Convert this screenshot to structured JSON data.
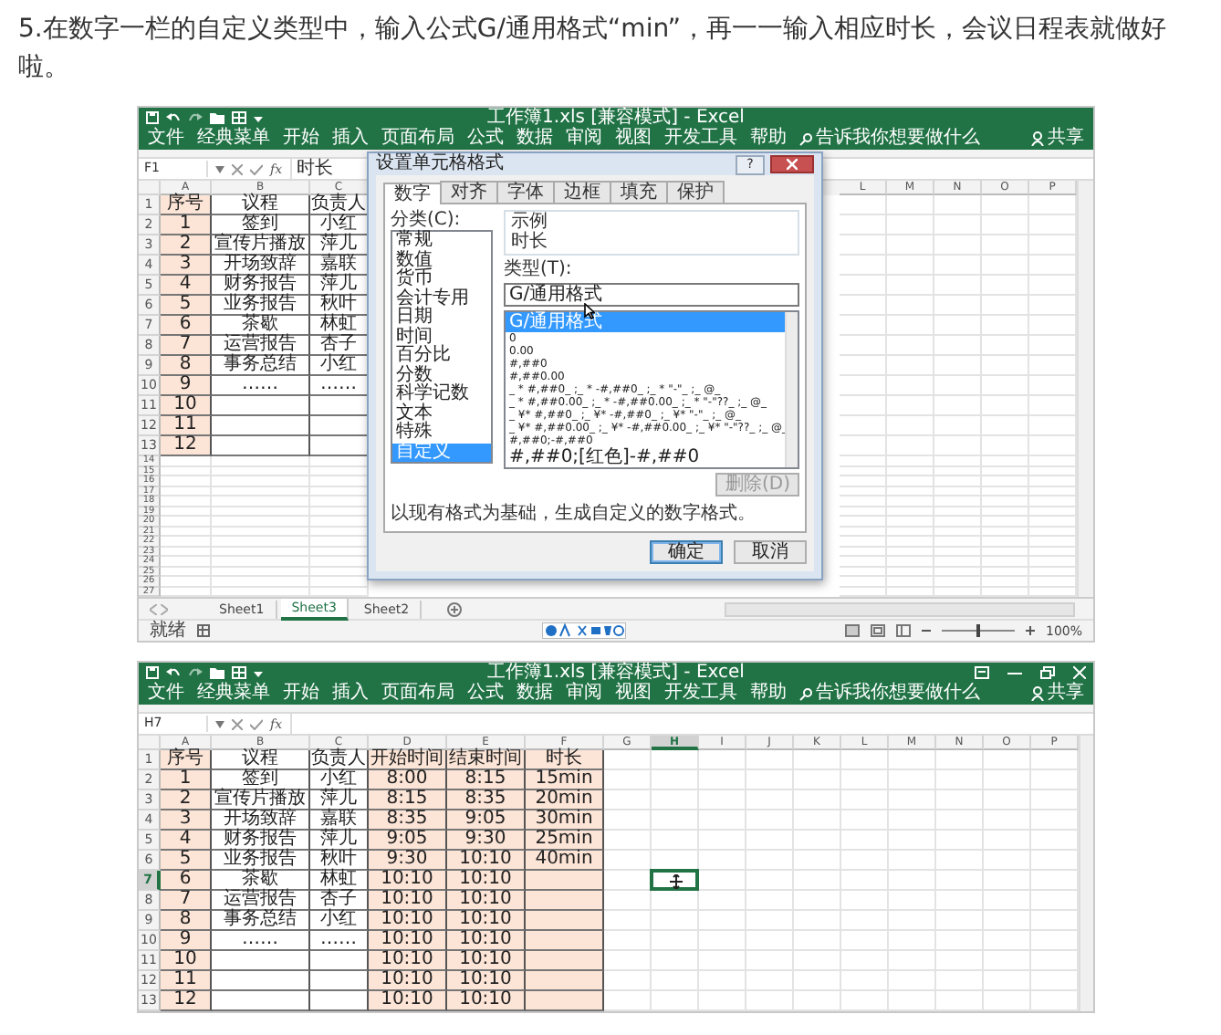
{
  "instruction": "5.在数字一栏的自定义类型中，输入公式G/通用格式“min”，再一一输入相应时长，会议日程表就做好啦。",
  "screenshots": [
    {
      "title": "工作簿1.xls [兼容模式] - Excel",
      "window_controls": false,
      "ribbon_tabs": [
        "文件",
        "经典菜单",
        "开始",
        "插入",
        "页面布局",
        "公式",
        "数据",
        "审阅",
        "视图",
        "开发工具",
        "帮助"
      ],
      "tell_me": "告诉我你想要做什么",
      "share": "共享",
      "formula_bar": {
        "name_box": "F1",
        "function_label": "fx",
        "value": "时长"
      },
      "grid": {
        "columns": [
          {
            "header": "A",
            "shaded": true,
            "selected": false
          },
          {
            "header": "B",
            "shaded": false,
            "selected": false
          },
          {
            "header": "C",
            "shaded": false,
            "selected": false
          },
          {
            "kind": "covered"
          },
          {
            "header": "L",
            "shaded": false,
            "selected": false
          },
          {
            "header": "M",
            "shaded": false,
            "selected": false
          },
          {
            "header": "N",
            "shaded": false,
            "selected": false
          },
          {
            "header": "O",
            "shaded": false,
            "selected": false
          },
          {
            "header": "P",
            "shaded": false,
            "selected": false
          }
        ],
        "rows": [
          {
            "number": "1",
            "selected": false,
            "cells": [
              "序号",
              "议程",
              "负责人"
            ]
          },
          {
            "number": "2",
            "selected": false,
            "cells": [
              "1",
              "签到",
              "小红"
            ]
          },
          {
            "number": "3",
            "selected": false,
            "cells": [
              "2",
              "宣传片播放",
              "萍儿"
            ]
          },
          {
            "number": "4",
            "selected": false,
            "cells": [
              "3",
              "开场致辞",
              "嘉联"
            ]
          },
          {
            "number": "5",
            "selected": false,
            "cells": [
              "4",
              "财务报告",
              "萍儿"
            ]
          },
          {
            "number": "6",
            "selected": false,
            "cells": [
              "5",
              "业务报告",
              "秋叶"
            ]
          },
          {
            "number": "7",
            "selected": false,
            "cells": [
              "6",
              "茶歇",
              "林虹"
            ]
          },
          {
            "number": "8",
            "selected": false,
            "cells": [
              "7",
              "运营报告",
              "杏子"
            ]
          },
          {
            "number": "9",
            "selected": false,
            "cells": [
              "8",
              "事务总结",
              "小红"
            ]
          },
          {
            "number": "10",
            "selected": false,
            "cells": [
              "9",
              "……",
              "……"
            ]
          },
          {
            "number": "11",
            "selected": false,
            "cells": [
              "10"
            ]
          },
          {
            "number": "12",
            "selected": false,
            "cells": [
              "11"
            ]
          },
          {
            "number": "13",
            "selected": false,
            "cells": [
              "12"
            ]
          },
          {
            "number": "14",
            "selected": false
          },
          {
            "number": "15",
            "selected": false
          },
          {
            "number": "16",
            "selected": false
          },
          {
            "number": "17",
            "selected": false
          },
          {
            "number": "18",
            "selected": false
          },
          {
            "number": "19",
            "selected": false
          },
          {
            "number": "20",
            "selected": false
          },
          {
            "number": "21",
            "selected": false
          },
          {
            "number": "22",
            "selected": false
          },
          {
            "number": "23",
            "selected": false
          },
          {
            "number": "24",
            "selected": false
          },
          {
            "number": "25",
            "selected": false
          },
          {
            "number": "26",
            "selected": false
          },
          {
            "number": "27",
            "selected": false
          }
        ]
      },
      "dialog": {
        "title": "设置单元格格式",
        "help": "?",
        "tabs": [
          {
            "label": "数字",
            "selected": true
          },
          {
            "label": "对齐",
            "selected": false
          },
          {
            "label": "字体",
            "selected": false
          },
          {
            "label": "边框",
            "selected": false
          },
          {
            "label": "填充",
            "selected": false
          },
          {
            "label": "保护",
            "selected": false
          }
        ],
        "category_label": "分类(C):",
        "categories": [
          {
            "label": "常规",
            "selected": false
          },
          {
            "label": "数值",
            "selected": false
          },
          {
            "label": "货币",
            "selected": false
          },
          {
            "label": "会计专用",
            "selected": false
          },
          {
            "label": "日期",
            "selected": false
          },
          {
            "label": "时间",
            "selected": false
          },
          {
            "label": "百分比",
            "selected": false
          },
          {
            "label": "分数",
            "selected": false
          },
          {
            "label": "科学记数",
            "selected": false
          },
          {
            "label": "文本",
            "selected": false
          },
          {
            "label": "特殊",
            "selected": false
          },
          {
            "label": "自定义",
            "selected": true
          }
        ],
        "sample_label": "示例",
        "sample_value": "时长",
        "type_label": "类型(T):",
        "type_value": "G/通用格式",
        "formats": [
          {
            "label": "G/通用格式",
            "selected": true
          },
          {
            "label": "0",
            "selected": false
          },
          {
            "label": "0.00",
            "selected": false
          },
          {
            "label": "#,##0",
            "selected": false
          },
          {
            "label": "#,##0.00",
            "selected": false
          },
          {
            "label": "_ * #,##0_ ;_ * -#,##0_ ;_ * \"-\"_ ;_ @_",
            "selected": false
          },
          {
            "label": "_ * #,##0.00_ ;_ * -#,##0.00_ ;_ * \"-\"??_ ;_ @_",
            "selected": false
          },
          {
            "label": "_ ¥* #,##0_ ;_ ¥* -#,##0_ ;_ ¥* \"-\"_ ;_ @_",
            "selected": false
          },
          {
            "label": "_ ¥* #,##0.00_ ;_ ¥* -#,##0.00_ ;_ ¥* \"-\"??_ ;_ @_",
            "selected": false
          },
          {
            "label": "#,##0;-#,##0",
            "selected": false
          },
          {
            "label": "#,##0;[红色]-#,##0",
            "selected": false
          }
        ],
        "delete_button": {
          "label": "删除(D)",
          "disabled": true
        },
        "description": "以现有格式为基础，生成自定义的数字格式。",
        "buttons": [
          {
            "label": "确定",
            "default": true
          },
          {
            "label": "取消",
            "default": false
          }
        ]
      },
      "sheet_tabs": [
        {
          "label": "Sheet1",
          "selected": false
        },
        {
          "label": "Sheet3",
          "selected": true
        },
        {
          "label": "Sheet2",
          "selected": false
        }
      ],
      "status": "就绪",
      "zoom": {
        "level": 0.5,
        "reading": "100%"
      }
    },
    {
      "title": "工作簿1.xls [兼容模式] - Excel",
      "window_controls": true,
      "ribbon_tabs": [
        "文件",
        "经典菜单",
        "开始",
        "插入",
        "页面布局",
        "公式",
        "数据",
        "审阅",
        "视图",
        "开发工具",
        "帮助"
      ],
      "tell_me": "告诉我你想要做什么",
      "share": "共享",
      "formula_bar": {
        "name_box": "H7",
        "function_label": "fx"
      },
      "grid": {
        "columns": [
          {
            "header": "A",
            "shaded": true,
            "selected": false
          },
          {
            "header": "B",
            "shaded": false,
            "selected": false
          },
          {
            "header": "C",
            "shaded": false,
            "selected": false
          },
          {
            "header": "D",
            "shaded": true,
            "selected": false
          },
          {
            "header": "E",
            "shaded": true,
            "selected": false
          },
          {
            "header": "F",
            "shaded": true,
            "selected": false
          },
          {
            "header": "G",
            "shaded": false,
            "selected": false
          },
          {
            "header": "H",
            "shaded": false,
            "selected": true
          },
          {
            "header": "I",
            "shaded": false,
            "selected": false
          },
          {
            "header": "J",
            "shaded": false,
            "selected": false
          },
          {
            "header": "K",
            "shaded": false,
            "selected": false
          },
          {
            "header": "L",
            "shaded": false,
            "selected": false
          },
          {
            "header": "M",
            "shaded": false,
            "selected": false
          },
          {
            "header": "N",
            "shaded": false,
            "selected": false
          },
          {
            "header": "O",
            "shaded": false,
            "selected": false
          },
          {
            "header": "P",
            "shaded": false,
            "selected": false
          }
        ],
        "rows": [
          {
            "number": "1",
            "selected": false,
            "cells": [
              "序号",
              "议程",
              "负责人",
              "开始时间",
              "结束时间",
              "时长"
            ]
          },
          {
            "number": "2",
            "selected": false,
            "cells": [
              "1",
              "签到",
              "小红",
              "8:00",
              "8:15",
              "15min"
            ]
          },
          {
            "number": "3",
            "selected": false,
            "cells": [
              "2",
              "宣传片播放",
              "萍儿",
              "8:15",
              "8:35",
              "20min"
            ]
          },
          {
            "number": "4",
            "selected": false,
            "cells": [
              "3",
              "开场致辞",
              "嘉联",
              "8:35",
              "9:05",
              "30min"
            ]
          },
          {
            "number": "5",
            "selected": false,
            "cells": [
              "4",
              "财务报告",
              "萍儿",
              "9:05",
              "9:30",
              "25min"
            ]
          },
          {
            "number": "6",
            "selected": false,
            "cells": [
              "5",
              "业务报告",
              "秋叶",
              "9:30",
              "10:10",
              "40min"
            ]
          },
          {
            "number": "7",
            "selected": true,
            "cells": [
              "6",
              "茶歇",
              "林虹",
              "10:10",
              "10:10"
            ]
          },
          {
            "number": "8",
            "selected": false,
            "cells": [
              "7",
              "运营报告",
              "杏子",
              "10:10",
              "10:10"
            ]
          },
          {
            "number": "9",
            "selected": false,
            "cells": [
              "8",
              "事务总结",
              "小红",
              "10:10",
              "10:10"
            ]
          },
          {
            "number": "10",
            "selected": false,
            "cells": [
              "9",
              "……",
              "……",
              "10:10",
              "10:10"
            ]
          },
          {
            "number": "11",
            "selected": false,
            "cells": [
              "10",
              "",
              "",
              "10:10",
              "10:10"
            ]
          },
          {
            "number": "12",
            "selected": false,
            "cells": [
              "11",
              "",
              "",
              "10:10",
              "10:10"
            ]
          },
          {
            "number": "13",
            "selected": false,
            "cells": [
              "12",
              "",
              "",
              "10:10",
              "10:10"
            ]
          }
        ]
      }
    }
  ]
}
